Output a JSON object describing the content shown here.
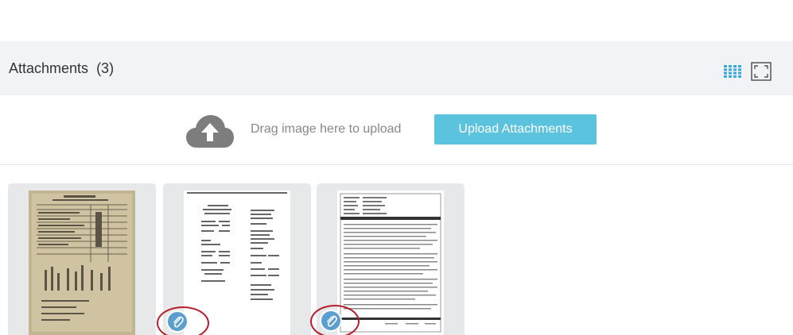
{
  "header": {
    "title": "Attachments",
    "count": "(3)"
  },
  "upload": {
    "drag_text": "Drag image here to upload",
    "button_label": "Upload Attachments"
  },
  "icons": {
    "grid_view": "grid-view-icon",
    "expand_view": "expand-icon",
    "cloud_upload": "cloud-upload-icon",
    "attachment": "paperclip-icon"
  },
  "colors": {
    "header_bg": "#f1f3f7",
    "accent": "#5cc3df",
    "grid_icon": "#3aa9d8",
    "badge": "#5b9fd0",
    "highlight": "#b71c2a"
  },
  "attachments": [
    {
      "id": "attachment-1",
      "badge": false
    },
    {
      "id": "attachment-2",
      "badge": true
    },
    {
      "id": "attachment-3",
      "badge": true
    }
  ]
}
